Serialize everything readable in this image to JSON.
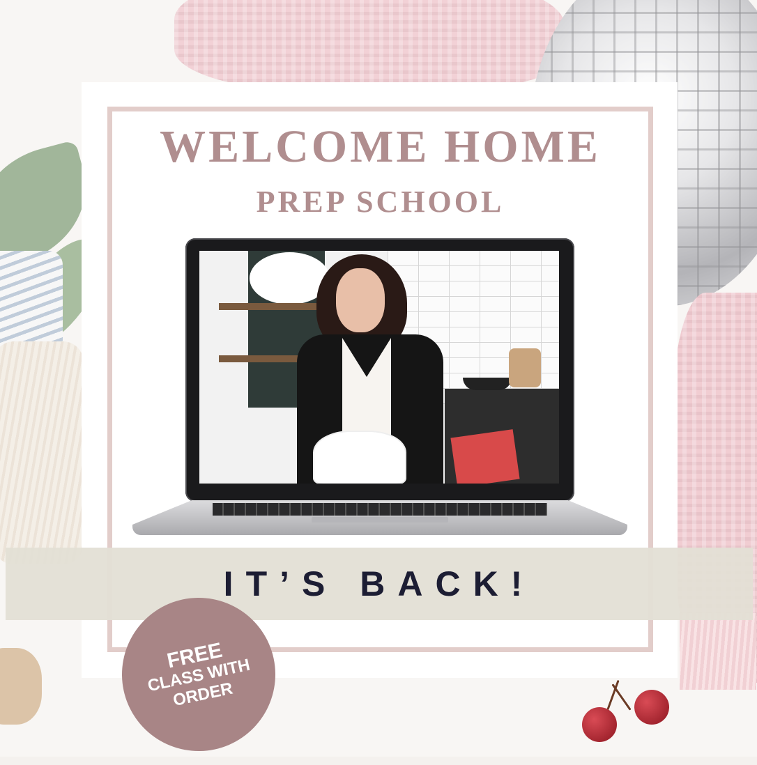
{
  "heading": {
    "title": "WELCOME HOME",
    "subtitle": "PREP SCHOOL"
  },
  "banner": {
    "text": "IT’S BACK!"
  },
  "badge": {
    "line1": "FREE",
    "line2": "CLASS WITH",
    "line3": "ORDER"
  },
  "colors": {
    "title_text": "#b08e8f",
    "frame": "#e2cdca",
    "banner_bg": "#e3dfd5",
    "banner_text": "#1c1d33",
    "badge_bg": "#a88586"
  },
  "icons": {
    "laptop": "laptop-icon",
    "cherries": "cherries-icon"
  }
}
